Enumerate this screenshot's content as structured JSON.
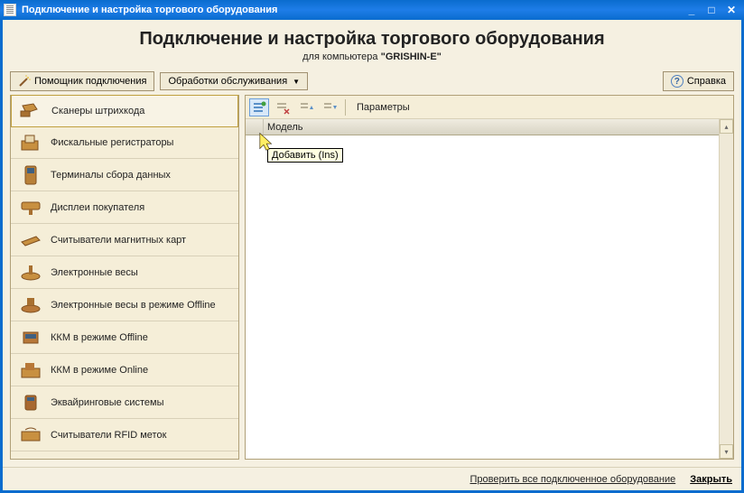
{
  "titlebar": {
    "text": "Подключение и настройка торгового оборудования"
  },
  "header": {
    "title": "Подключение и настройка торгового оборудования",
    "subtitle_prefix": "для компьютера ",
    "computer_name": "\"GRISHIN-E\""
  },
  "toolbar": {
    "assistant_label": "Помощник подключения",
    "service_label": "Обработки обслуживания",
    "help_label": "Справка"
  },
  "sidebar": {
    "items": [
      {
        "label": "Сканеры штрихкода",
        "icon": "barcode-scanner"
      },
      {
        "label": "Фискальные регистраторы",
        "icon": "fiscal-printer"
      },
      {
        "label": "Терминалы сбора данных",
        "icon": "data-terminal"
      },
      {
        "label": "Дисплеи покупателя",
        "icon": "customer-display"
      },
      {
        "label": "Считыватели магнитных карт",
        "icon": "card-reader"
      },
      {
        "label": "Электронные весы",
        "icon": "scale"
      },
      {
        "label": "Электронные весы в режиме Offline",
        "icon": "scale-offline"
      },
      {
        "label": "ККМ в режиме Offline",
        "icon": "cash-register-offline"
      },
      {
        "label": "ККМ в режиме Online",
        "icon": "cash-register-online"
      },
      {
        "label": "Эквайринговые системы",
        "icon": "pos-terminal"
      },
      {
        "label": "Считыватели RFID меток",
        "icon": "rfid-reader"
      }
    ],
    "selected_index": 0
  },
  "panel": {
    "params_label": "Параметры",
    "column_header": "Модель",
    "tooltip": "Добавить (Ins)"
  },
  "footer": {
    "check_label": "Проверить все подключенное оборудование",
    "close_label": "Закрыть"
  }
}
